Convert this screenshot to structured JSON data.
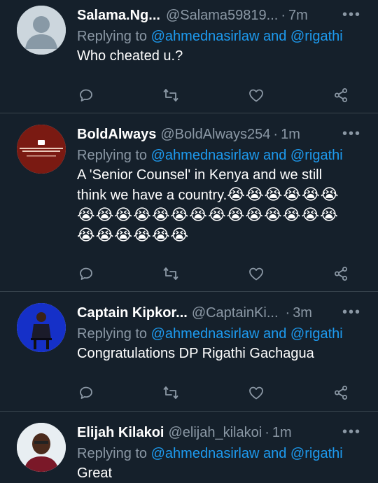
{
  "tweets": [
    {
      "name": "Salama.Ng...",
      "handle": "@Salama59819...",
      "time": "7m",
      "replying_prefix": "Replying to",
      "replying_to": "@ahmednasirlaw and @rigathi",
      "text": "Who cheated u.?",
      "emojis": ""
    },
    {
      "name": "BoldAlways",
      "handle": "@BoldAlways254",
      "time": "1m",
      "replying_prefix": "Replying to",
      "replying_to": "@ahmednasirlaw and @rigathi",
      "text": "A 'Senior Counsel' in Kenya and we still think we have a country.",
      "emojis": "😭😭😭😭😭😭😭😭😭😭😭😭😭😭😭😭😭😭😭😭😭😭😭😭😭😭"
    },
    {
      "name": "Captain Kipkor...",
      "handle": "@CaptainKi...",
      "time": "3m",
      "replying_prefix": "Replying to",
      "replying_to": "@ahmednasirlaw and @rigathi",
      "text": "Congratulations DP Rigathi Gachagua",
      "emojis": ""
    },
    {
      "name": "Elijah Kilakoi",
      "handle": "@elijah_kilakoi",
      "time": "1m",
      "replying_prefix": "Replying to",
      "replying_to": "@ahmednasirlaw and @rigathi",
      "text": "Great",
      "emojis": ""
    }
  ],
  "separator": "·",
  "icons": [
    "reply-icon",
    "retweet-icon",
    "like-icon",
    "share-icon",
    "more-icon"
  ],
  "colors": {
    "background": "#15202b",
    "link": "#1d9bf0",
    "muted": "#8b98a5",
    "border": "#38444d"
  }
}
